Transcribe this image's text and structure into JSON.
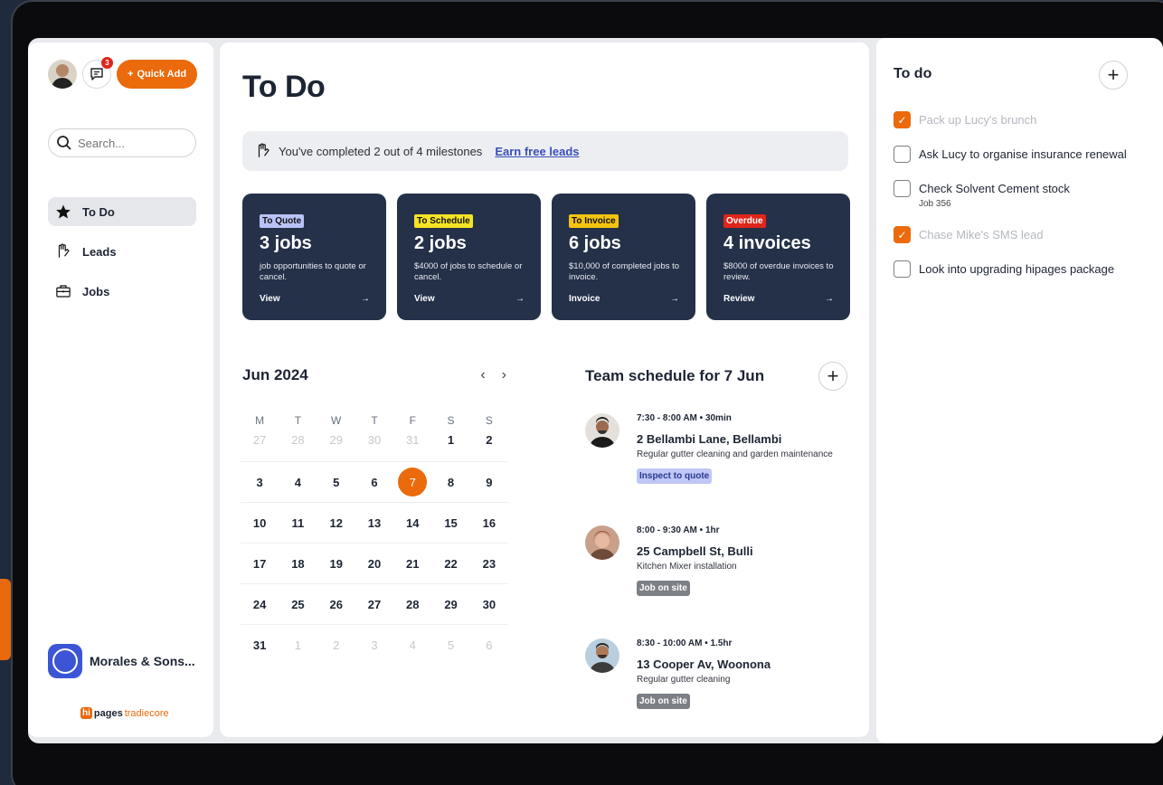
{
  "sidebar": {
    "notification_count": "3",
    "quick_add_label": "Quick Add",
    "search_placeholder": "Search...",
    "nav": [
      {
        "label": "To Do",
        "icon": "star-icon",
        "active": true
      },
      {
        "label": "Leads",
        "icon": "hand-icon",
        "active": false
      },
      {
        "label": "Jobs",
        "icon": "briefcase-icon",
        "active": false
      }
    ],
    "company_name": "Morales & Sons...",
    "brand_hi": "hi",
    "brand_pages": "pages",
    "brand_tradiecore": "tradiecore"
  },
  "main": {
    "title": "To Do",
    "milestone_text": "You've completed 2 out of 4 milestones",
    "milestone_link": "Earn free leads",
    "cards": [
      {
        "tag": "To Quote",
        "tag_color": "#b9c3f7",
        "title": "3 jobs",
        "desc": "job opportunities to quote or cancel.",
        "action": "View"
      },
      {
        "tag": "To Schedule",
        "tag_color": "#f4e424",
        "title": "2 jobs",
        "desc": "$4000 of jobs to schedule or cancel.",
        "action": "View"
      },
      {
        "tag": "To Invoice",
        "tag_color": "#f4c40f",
        "title": "6 jobs",
        "desc": "$10,000 of completed jobs to invoice.",
        "action": "Invoice"
      },
      {
        "tag": "Overdue",
        "tag_color": "#e0251b",
        "title": "4 invoices",
        "desc": "$8000 of overdue invoices to review.",
        "action": "Review"
      }
    ],
    "calendar": {
      "month_label": "Jun 2024",
      "weekdays": [
        "M",
        "T",
        "W",
        "T",
        "F",
        "S",
        "S"
      ],
      "weeks": [
        [
          "27",
          "28",
          "29",
          "30",
          "31",
          "1",
          "2"
        ],
        [
          "3",
          "4",
          "5",
          "6",
          "7",
          "8",
          "9"
        ],
        [
          "10",
          "11",
          "12",
          "13",
          "14",
          "15",
          "16"
        ],
        [
          "17",
          "18",
          "19",
          "20",
          "21",
          "22",
          "23"
        ],
        [
          "24",
          "25",
          "26",
          "27",
          "28",
          "29",
          "30"
        ],
        [
          "31",
          "1",
          "2",
          "3",
          "4",
          "5",
          "6"
        ]
      ],
      "selected_day": "7"
    },
    "schedule": {
      "title": "Team schedule for 7 Jun",
      "items": [
        {
          "time": "7:30 - 8:00 AM",
          "duration": "30min",
          "address": "2 Bellambi Lane, Bellambi",
          "desc": "Regular gutter cleaning and garden maintenance",
          "tag": "Inspect to quote",
          "tag_color": "#bfc6f8",
          "tag_text_color": "#2b3a8f"
        },
        {
          "time": "8:00 - 9:30 AM",
          "duration": "1hr",
          "address": "25 Campbell St, Bulli",
          "desc": "Kitchen Mixer installation",
          "tag": "Job on site",
          "tag_color": "#7c7f86",
          "tag_text_color": "#ffffff"
        },
        {
          "time": "8:30 - 10:00 AM",
          "duration": "1.5hr",
          "address": "13 Cooper Av, Woonona",
          "desc": "Regular gutter cleaning",
          "tag": "Job on site",
          "tag_color": "#7c7f86",
          "tag_text_color": "#ffffff"
        }
      ]
    }
  },
  "todo_panel": {
    "title": "To do",
    "items": [
      {
        "text": "Pack up Lucy's brunch",
        "checked": true,
        "sub": ""
      },
      {
        "text": "Ask Lucy to organise insurance renewal",
        "checked": false,
        "sub": ""
      },
      {
        "text": "Check Solvent Cement stock",
        "checked": false,
        "sub": "Job 356"
      },
      {
        "text": "Chase Mike's SMS lead",
        "checked": true,
        "sub": ""
      },
      {
        "text": "Look into upgrading hipages package",
        "checked": false,
        "sub": ""
      }
    ]
  },
  "colors": {
    "accent": "#ea6a0c",
    "card_bg": "#243149",
    "link": "#3b4fb8"
  }
}
